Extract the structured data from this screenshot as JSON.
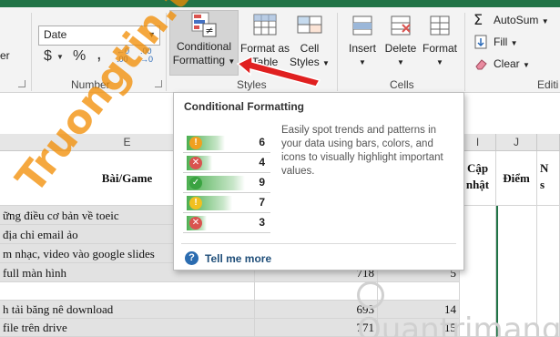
{
  "ribbon": {
    "number_format_value": "Date",
    "number_group_label": "Number",
    "styles_group_label": "Styles",
    "cells_group_label": "Cells",
    "editing_group_label": "Editi",
    "left_partial_label": "er",
    "currency_symbol": "$",
    "percent_symbol": "%",
    "comma_symbol": ",",
    "conditional_formatting_label_1": "Conditional",
    "conditional_formatting_label_2": "Formatting",
    "format_as_table_label_1": "Format as",
    "format_as_table_label_2": "Table",
    "cell_styles_label_1": "Cell",
    "cell_styles_label_2": "Styles",
    "insert_label": "Insert",
    "delete_label": "Delete",
    "format_label": "Format",
    "autosum_label": "AutoSum",
    "fill_label": "Fill",
    "clear_label": "Clear"
  },
  "sheet": {
    "col_e": "E",
    "col_i": "I",
    "col_j": "J",
    "header_game": "Bài/Game",
    "header_update_1": "Cập",
    "header_update_2": "nhật",
    "header_score": "Điểm",
    "header_partial_1": "N",
    "header_partial_2": "s",
    "rows": [
      {
        "e": "ững điều cơ bản về toeic",
        "g": "",
        "h": ""
      },
      {
        "e": " địa chỉ email ảo",
        "g": "",
        "h": ""
      },
      {
        "e": "m nhạc, video vào google slides",
        "g": "",
        "h": ""
      },
      {
        "e": " full màn hình",
        "g": "718",
        "h": "5"
      },
      {
        "e": "",
        "g": "",
        "h": ""
      },
      {
        "e": "h tải băng nê download",
        "g": "693",
        "h": "14"
      },
      {
        "e": " file trên drive",
        "g": "771",
        "h": "15"
      }
    ]
  },
  "tooltip": {
    "title": "Conditional Formatting",
    "description": "Easily spot trends and patterns in your data using bars, colors, and icons to visually highlight important values.",
    "tell_me_more": "Tell me more",
    "preview_rows": [
      {
        "icon": "exclaim-icon",
        "color": "#f0a020",
        "value": "6",
        "bar": 0.66
      },
      {
        "icon": "cross-icon",
        "color": "#d9534f",
        "value": "4",
        "bar": 0.44
      },
      {
        "icon": "check-icon",
        "color": "#3aa341",
        "value": "9",
        "bar": 1.0
      },
      {
        "icon": "exclaim-icon",
        "color": "#f0c020",
        "value": "7",
        "bar": 0.77
      },
      {
        "icon": "cross-icon",
        "color": "#d9534f",
        "value": "3",
        "bar": 0.33
      }
    ]
  },
  "watermarks": {
    "left": "Truongtin.top",
    "right": "Quantrimang"
  },
  "colors": {
    "excel_green": "#217346",
    "arrow_red": "#e02020"
  }
}
